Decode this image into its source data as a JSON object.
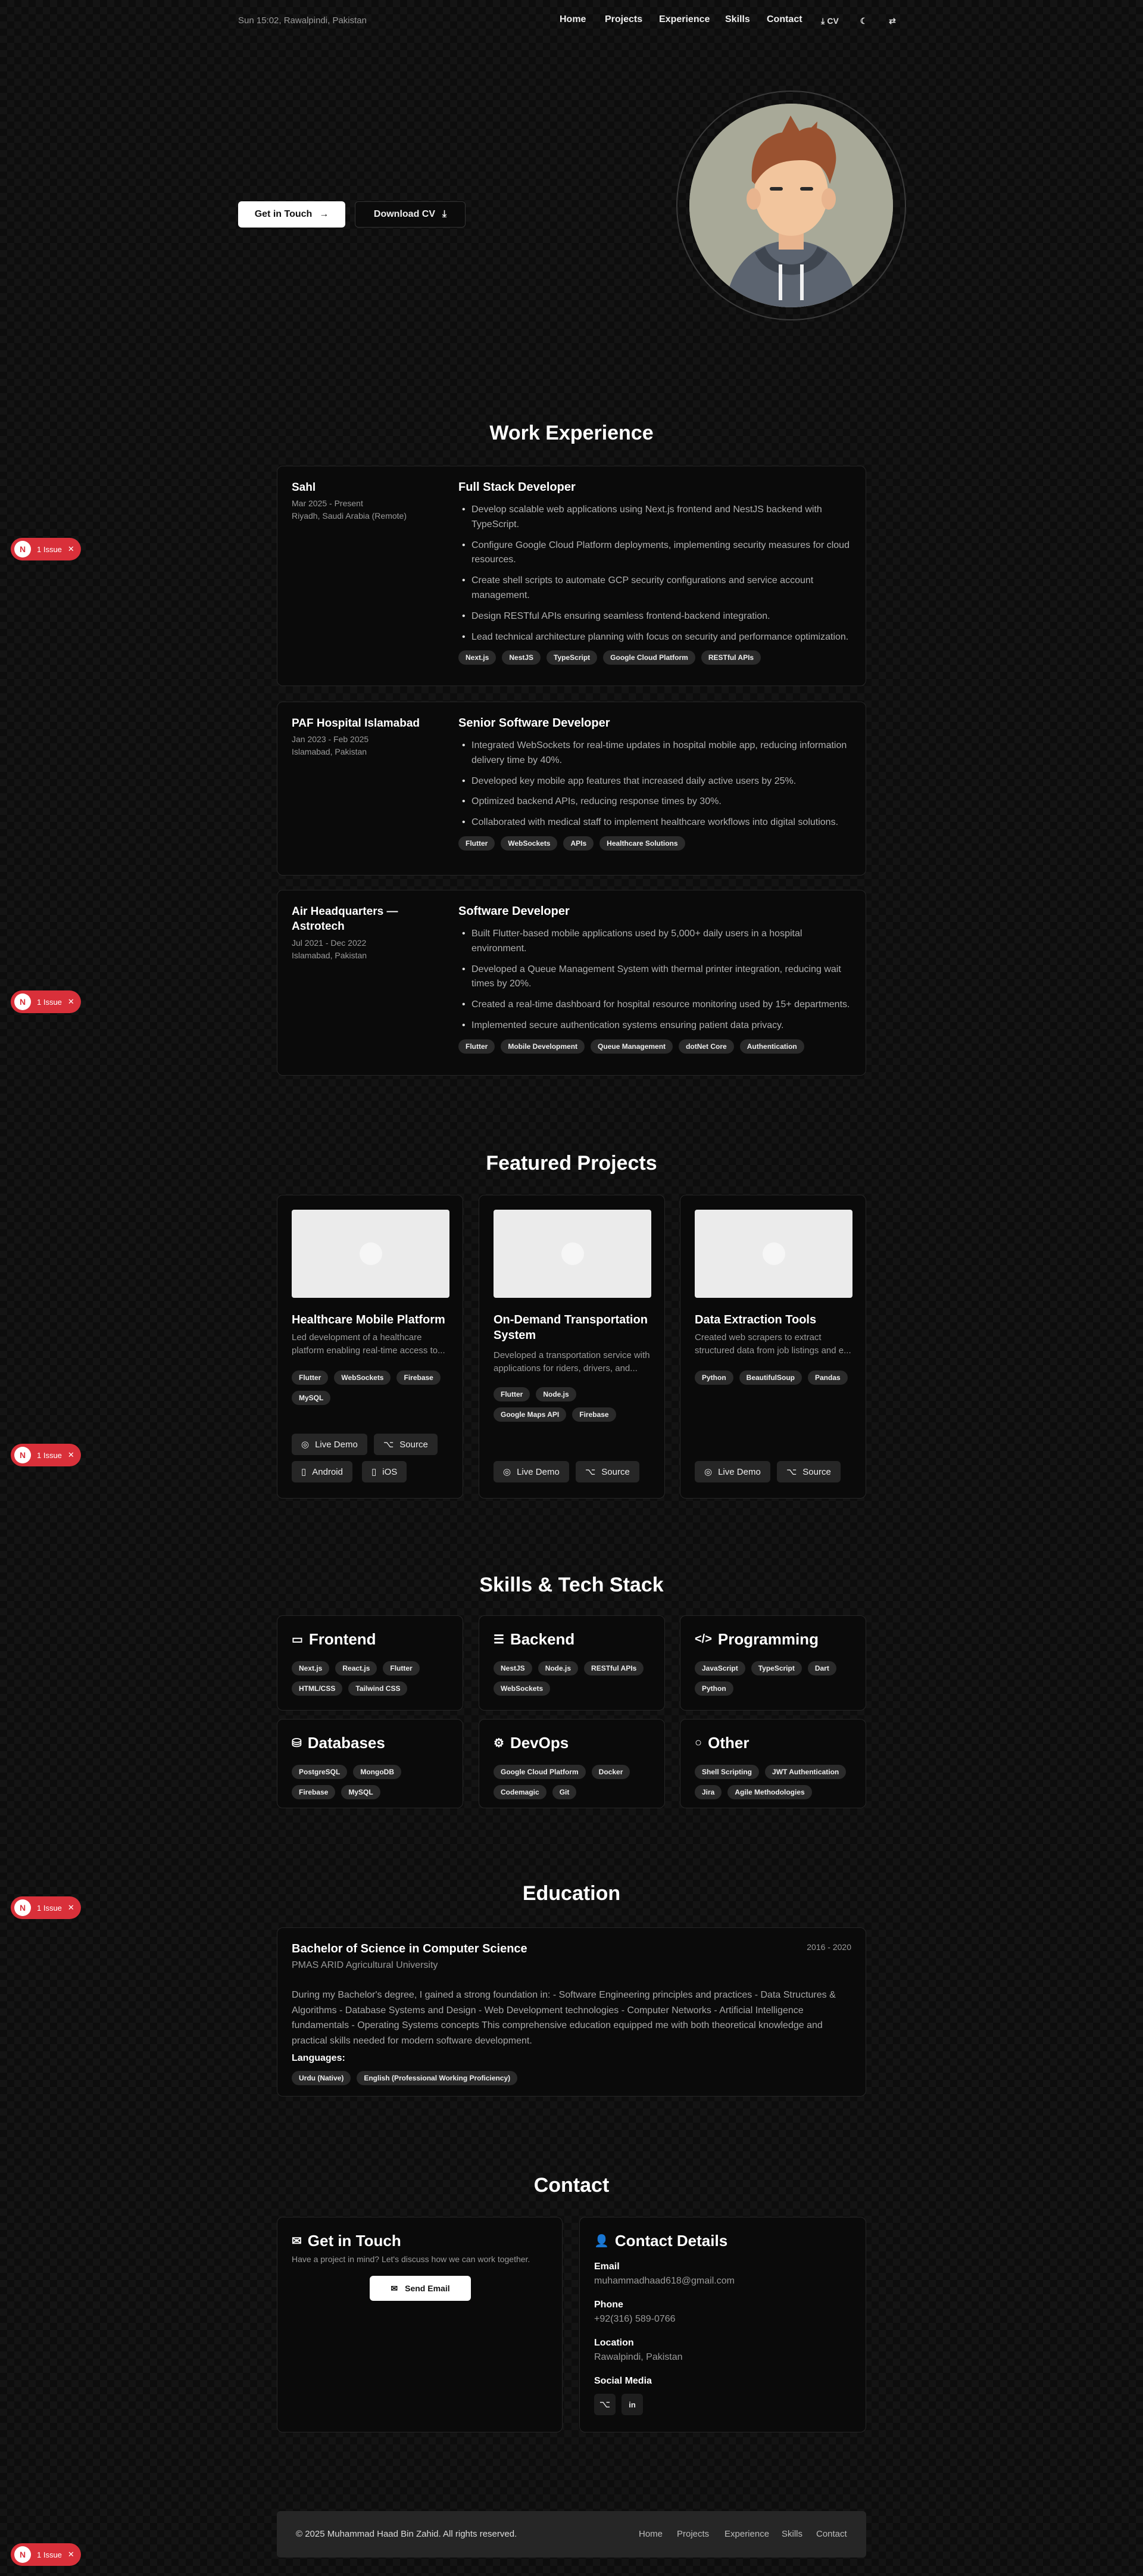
{
  "header": {
    "datetime": "Sun 15:02, Rawalpindi, Pakistan",
    "nav": [
      "Home",
      "Projects",
      "Experience",
      "Skills",
      "Contact"
    ],
    "cv_label": "CV"
  },
  "hero": {
    "get_in_touch": "Get in Touch",
    "download_cv": "Download CV"
  },
  "experience": {
    "title": "Work Experience",
    "items": [
      {
        "company": "Sahl",
        "dates": "Mar 2025 - Present",
        "location": "Riyadh, Saudi Arabia (Remote)",
        "role": "Full Stack Developer",
        "bullets": [
          "Develop scalable web applications using Next.js frontend and NestJS backend with TypeScript.",
          "Configure Google Cloud Platform deployments, implementing security measures for cloud resources.",
          "Create shell scripts to automate GCP security configurations and service account management.",
          "Design RESTful APIs ensuring seamless frontend-backend integration.",
          "Lead technical architecture planning with focus on security and performance optimization."
        ],
        "tags": [
          "Next.js",
          "NestJS",
          "TypeScript",
          "Google Cloud Platform",
          "RESTful APIs"
        ]
      },
      {
        "company": "PAF Hospital Islamabad",
        "dates": "Jan 2023 - Feb 2025",
        "location": "Islamabad, Pakistan",
        "role": "Senior Software Developer",
        "bullets": [
          "Integrated WebSockets for real-time updates in hospital mobile app, reducing information delivery time by 40%.",
          "Developed key mobile app features that increased daily active users by 25%.",
          "Optimized backend APIs, reducing response times by 30%.",
          "Collaborated with medical staff to implement healthcare workflows into digital solutions."
        ],
        "tags": [
          "Flutter",
          "WebSockets",
          "APIs",
          "Healthcare Solutions"
        ]
      },
      {
        "company": "Air Headquarters — Astrotech",
        "dates": "Jul 2021 - Dec 2022",
        "location": "Islamabad, Pakistan",
        "role": "Software Developer",
        "bullets": [
          "Built Flutter-based mobile applications used by 5,000+ daily users in a hospital environment.",
          "Developed a Queue Management System with thermal printer integration, reducing wait times by 20%.",
          "Created a real-time dashboard for hospital resource monitoring used by 15+ departments.",
          "Implemented secure authentication systems ensuring patient data privacy."
        ],
        "tags": [
          "Flutter",
          "Mobile Development",
          "Queue Management",
          "dotNet Core",
          "Authentication"
        ]
      }
    ]
  },
  "projects": {
    "title": "Featured Projects",
    "items": [
      {
        "title": "Healthcare Mobile Platform",
        "desc": "Led development of a healthcare platform enabling real-time access to...",
        "tags": [
          "Flutter",
          "WebSockets",
          "Firebase",
          "MySQL"
        ],
        "buttons": [
          "Live Demo",
          "Source",
          "Android",
          "iOS"
        ]
      },
      {
        "title": "On-Demand Transportation System",
        "desc": "Developed a transportation service with applications for riders, drivers, and...",
        "tags": [
          "Flutter",
          "Node.js",
          "Google Maps API",
          "Firebase"
        ],
        "buttons": [
          "Live Demo",
          "Source"
        ]
      },
      {
        "title": "Data Extraction Tools",
        "desc": "Created web scrapers to extract structured data from job listings and e...",
        "tags": [
          "Python",
          "BeautifulSoup",
          "Pandas"
        ],
        "buttons": [
          "Live Demo",
          "Source"
        ]
      }
    ]
  },
  "skills": {
    "title": "Skills & Tech Stack",
    "groups": [
      {
        "name": "Frontend",
        "icon": "monitor-icon",
        "tags": [
          "Next.js",
          "React.js",
          "Flutter",
          "HTML/CSS",
          "Tailwind CSS"
        ]
      },
      {
        "name": "Backend",
        "icon": "server-icon",
        "tags": [
          "NestJS",
          "Node.js",
          "RESTful APIs",
          "WebSockets"
        ]
      },
      {
        "name": "Programming",
        "icon": "code-icon",
        "tags": [
          "JavaScript",
          "TypeScript",
          "Dart",
          "Python"
        ]
      },
      {
        "name": "Databases",
        "icon": "database-icon",
        "tags": [
          "PostgreSQL",
          "MongoDB",
          "Firebase",
          "MySQL"
        ]
      },
      {
        "name": "DevOps",
        "icon": "gear-icon",
        "tags": [
          "Google Cloud Platform",
          "Docker",
          "Codemagic",
          "Git"
        ]
      },
      {
        "name": "Other",
        "icon": "circle-icon",
        "tags": [
          "Shell Scripting",
          "JWT Authentication",
          "Jira",
          "Agile Methodologies"
        ]
      }
    ]
  },
  "education": {
    "title": "Education",
    "degree": "Bachelor of Science in Computer Science",
    "school": "PMAS ARID Agricultural University",
    "years": "2016 - 2020",
    "description": "During my Bachelor's degree, I gained a strong foundation in: - Software Engineering principles and practices - Data Structures & Algorithms - Database Systems and Design - Web Development technologies - Computer Networks - Artificial Intelligence fundamentals - Operating Systems concepts This comprehensive education equipped me with both theoretical knowledge and practical skills needed for modern software development.",
    "languages_label": "Languages:",
    "languages": [
      "Urdu (Native)",
      "English (Professional Working Proficiency)"
    ]
  },
  "contact": {
    "title": "Contact",
    "touch_title": "Get in Touch",
    "touch_text": "Have a project in mind? Let's discuss how we can work together.",
    "send_email": "Send Email",
    "details_title": "Contact Details",
    "email_label": "Email",
    "email": "muhammadhaad618@gmail.com",
    "phone_label": "Phone",
    "phone": "+92(316) 589-0766",
    "location_label": "Location",
    "location": "Rawalpindi, Pakistan",
    "social_label": "Social Media"
  },
  "footer": {
    "copyright": "© 2025 Muhammad Haad Bin Zahid. All rights reserved.",
    "links": [
      "Home",
      "Projects",
      "Experience",
      "Skills",
      "Contact"
    ]
  },
  "issue_badge": {
    "letter": "N",
    "label": "1 Issue"
  },
  "colors": {
    "accent_red": "#d9303a",
    "card_bg": "#0a0a0a",
    "tag_bg": "#2a2a2a"
  }
}
